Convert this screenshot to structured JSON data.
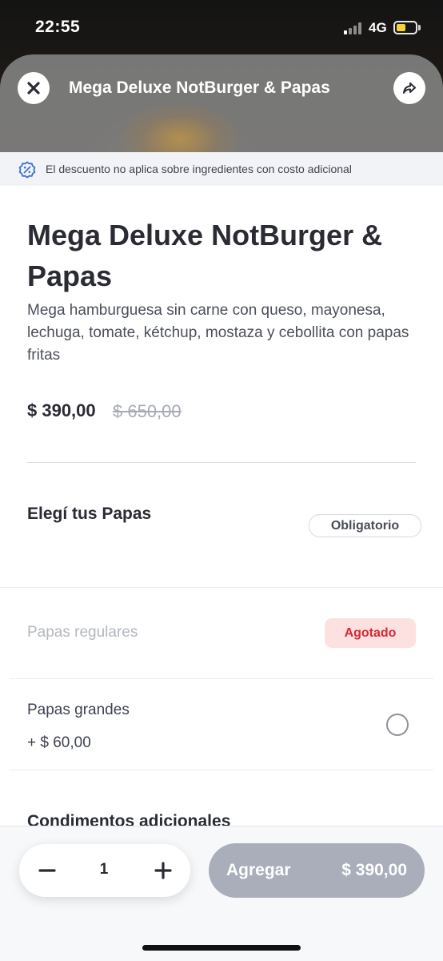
{
  "status_bar": {
    "time": "22:55",
    "network": "4G",
    "battery_level": 0.5
  },
  "nav": {
    "title": "Mega Deluxe NotBurger & Papas",
    "close_icon": "close-icon",
    "share_icon": "share-icon"
  },
  "notice": {
    "icon": "discount-badge-icon",
    "text": "El descuento no aplica sobre ingredientes con costo adicional"
  },
  "product": {
    "title": "Mega Deluxe NotBurger & Papas",
    "description": "Mega hamburguesa sin carne con queso, mayonesa, lechuga, tomate, kétchup, mostaza y cebollita con papas fritas",
    "price": "$ 390,00",
    "old_price": "$ 650,00"
  },
  "section_fries": {
    "title": "Elegí tus Papas",
    "badge": "Obligatorio",
    "options": [
      {
        "label": "Papas regulares",
        "status": "Agotado",
        "available": false
      },
      {
        "label": "Papas grandes",
        "price": "+ $ 60,00",
        "available": true,
        "selected": false
      }
    ]
  },
  "section_condiments": {
    "title": "Condimentos adicionales"
  },
  "bottom_bar": {
    "quantity": "1",
    "add_label": "Agregar",
    "add_price": "$ 390,00"
  },
  "colors": {
    "accent_disabled": "#a9aeba",
    "soldout_bg": "#fde0e0",
    "soldout_text": "#d42b34",
    "notice_icon": "#3b6fd8"
  }
}
